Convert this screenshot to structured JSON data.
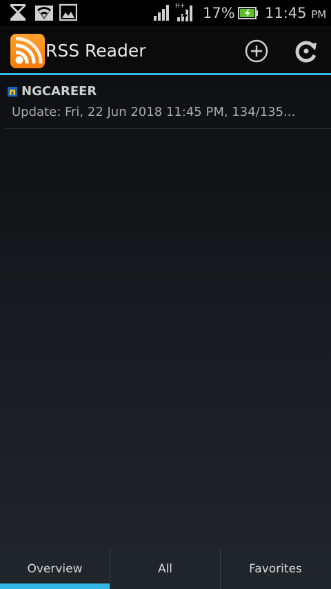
{
  "status_bar": {
    "battery_percent": "17%",
    "time": "11:45",
    "ampm": "PM",
    "network_type": "H+",
    "icons": [
      "hourglass-icon",
      "wifi-icon",
      "image-icon",
      "signal-icon",
      "signal-hplus-icon",
      "battery-charging-icon"
    ]
  },
  "action_bar": {
    "app_title": "RSS Reader",
    "app_icon": "rss-app-icon",
    "actions": [
      "add-feed-icon",
      "refresh-icon"
    ]
  },
  "feeds": [
    {
      "name": "NGCAREER",
      "update_text": "Update: Fri, 22 Jun 2018 11:45 PM, 134/135..."
    }
  ],
  "tabs": [
    {
      "label": "Overview",
      "selected": true
    },
    {
      "label": "All",
      "selected": false
    },
    {
      "label": "Favorites",
      "selected": false
    }
  ],
  "colors": {
    "accent": "#33b5e5",
    "app_icon_orange": "#f48a1a"
  }
}
